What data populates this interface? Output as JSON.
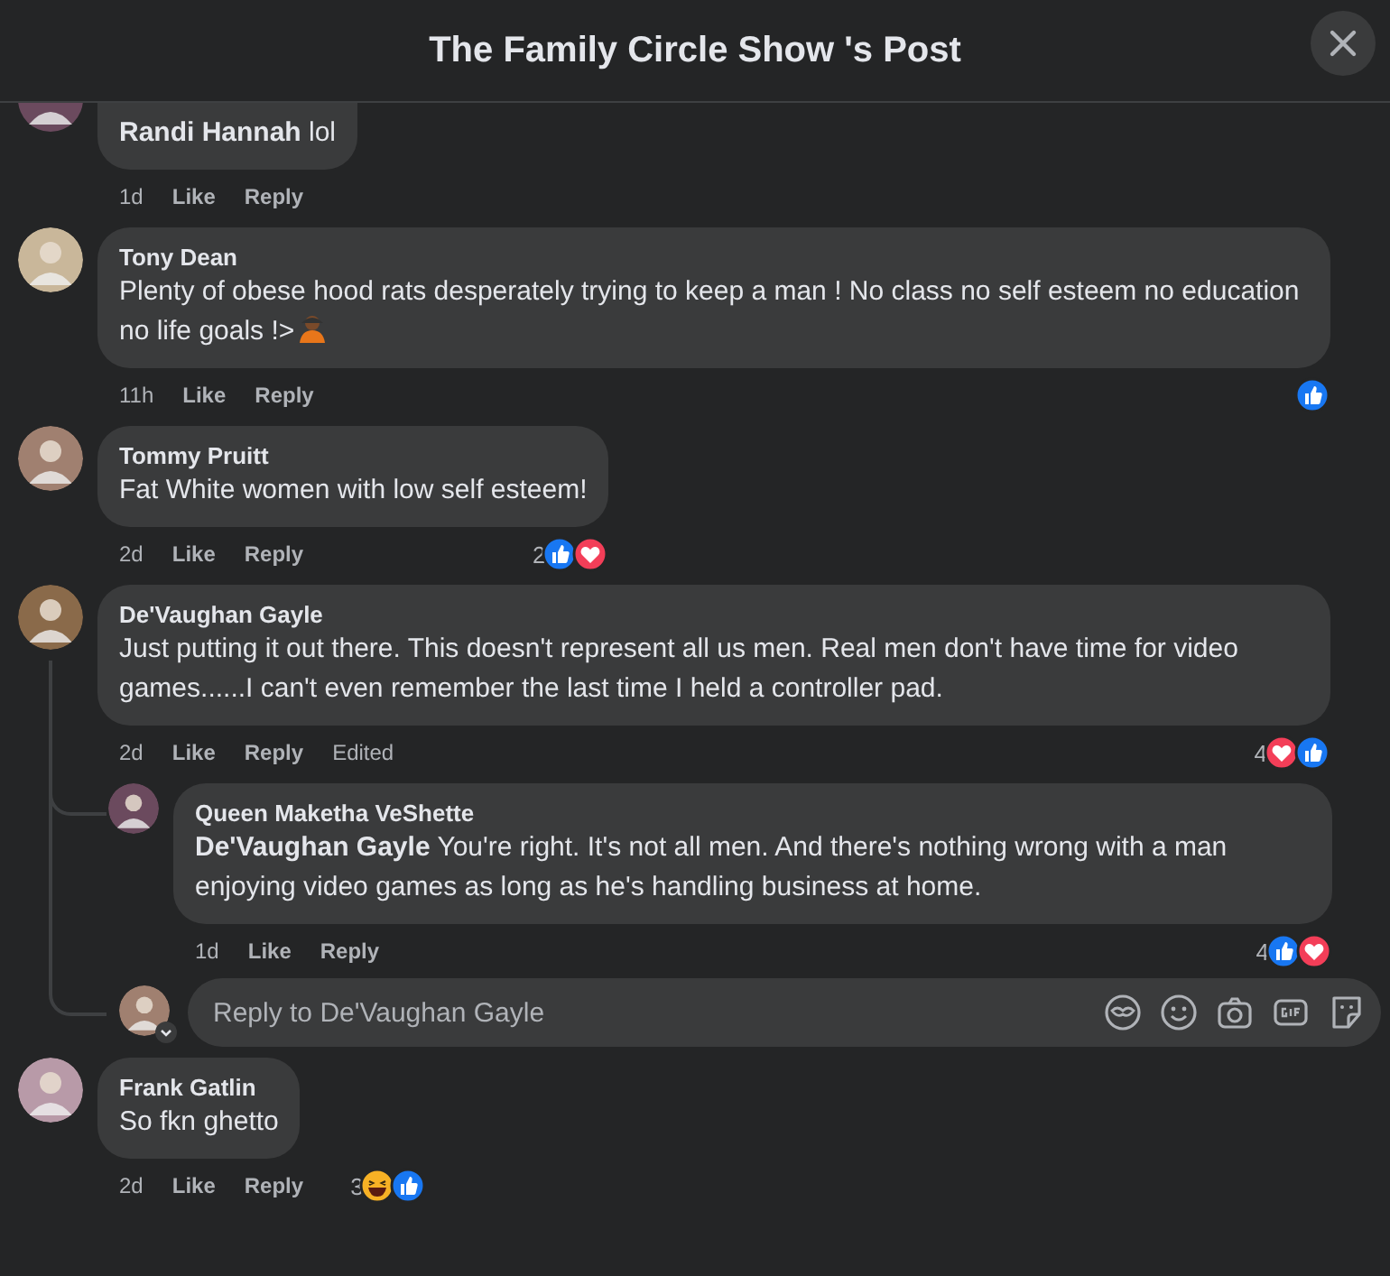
{
  "header": {
    "title": "The Family Circle Show 's Post"
  },
  "comments": [
    {
      "text": "**Randi Hannah** lol",
      "time": "1d",
      "actions": [
        "Like",
        "Reply"
      ]
    },
    {
      "author": "Tony Dean",
      "text": "Plenty of obese hood rats desperately trying to keep a man ! No class no self esteem no education no life goals !>",
      "inline_icon": {
        "kind": "person"
      },
      "time": "11h",
      "actions": [
        "Like",
        "Reply"
      ],
      "reactions": {
        "icons": [
          {
            "kind": "like"
          }
        ]
      }
    },
    {
      "author": "Tommy Pruitt",
      "text": "Fat White women with low self esteem!",
      "time": "2d",
      "actions": [
        "Like",
        "Reply"
      ],
      "reactions": {
        "count": "2",
        "icons": [
          {
            "kind": "like"
          },
          {
            "kind": "love"
          }
        ]
      }
    },
    {
      "author": "De'Vaughan Gayle",
      "text": "Just putting it out there. This doesn't represent all us men. Real men don't have time for video games......I can't even remember the last time I held a controller pad.",
      "time": "2d",
      "actions": [
        "Like",
        "Reply"
      ],
      "edited_label": "Edited",
      "reactions": {
        "count": "4",
        "icons": [
          {
            "kind": "love"
          },
          {
            "kind": "like"
          }
        ]
      },
      "replies": [
        {
          "author": "Queen Maketha VeShette",
          "text": "**De'Vaughan Gayle** You're right. It's not all men. And there's nothing wrong with a man enjoying video games as long as he's handling business at home.",
          "time": "1d",
          "actions": [
            "Like",
            "Reply"
          ],
          "reactions": {
            "count": "4",
            "icons": [
              {
                "kind": "like"
              },
              {
                "kind": "love"
              }
            ]
          }
        }
      ],
      "reply_box": {
        "placeholder": "Reply to De'Vaughan Gayle"
      }
    },
    {
      "author": "Frank Gatlin",
      "text": "So fkn ghetto",
      "time": "2d",
      "actions": [
        "Like",
        "Reply"
      ],
      "reactions": {
        "count": "3",
        "icons": [
          {
            "kind": "haha"
          },
          {
            "kind": "like"
          }
        ]
      }
    }
  ]
}
